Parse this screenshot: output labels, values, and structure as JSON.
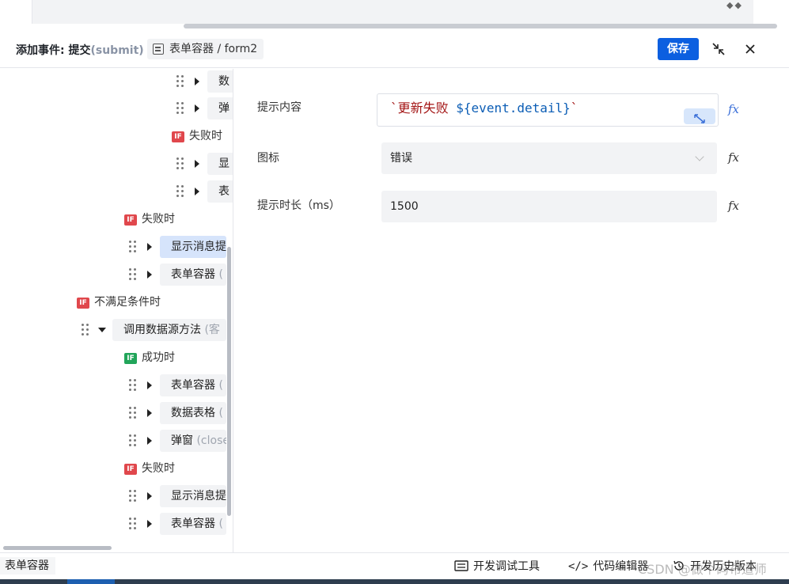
{
  "header": {
    "title": "添加事件: 提交",
    "title_sub": "(submit)",
    "crumb": "表单容器 / form2",
    "save_label": "保存"
  },
  "tree": {
    "nodes": [
      {
        "label": "数",
        "muted": ""
      },
      {
        "label": "弹",
        "muted": ""
      },
      {
        "label": "显",
        "muted": ""
      },
      {
        "label": "表",
        "muted": ""
      },
      {
        "label": "显示消息提",
        "muted": ""
      },
      {
        "label": "表单容器",
        "muted": " ("
      },
      {
        "label": "调用数据源方法",
        "muted": " (客"
      },
      {
        "label": "表单容器",
        "muted": " ("
      },
      {
        "label": "数据表格",
        "muted": " ("
      },
      {
        "label": "弹窗",
        "muted": " (close"
      },
      {
        "label": "显示消息提",
        "muted": ""
      },
      {
        "label": "表单容器",
        "muted": " ("
      }
    ],
    "conditions": [
      {
        "badge": "IF",
        "label": "失败时"
      },
      {
        "badge": "IF",
        "label": "失败时"
      },
      {
        "badge": "IF",
        "label": "不满足条件时"
      },
      {
        "badge": "IF",
        "label": "成功时"
      },
      {
        "badge": "IF",
        "label": "失败时"
      }
    ]
  },
  "form": {
    "fields": [
      {
        "label": "提示内容",
        "code_prefix": "`更新失败 ",
        "code_var": "${event.detail}",
        "code_suffix": "`"
      },
      {
        "label": "图标",
        "value": "错误"
      },
      {
        "label": "提示时长（ms）",
        "value": "1500"
      }
    ],
    "fx_label": "fx"
  },
  "footer": {
    "crumb": "表单容器",
    "tools": [
      "开发调试工具",
      "代码编辑器",
      "开发历史版本"
    ]
  },
  "watermark": "CSDN @做个码布道师",
  "colors": {
    "primary": "#0c5fe0",
    "if_red": "#e0474c",
    "if_green": "#22a55a",
    "active_node": "#d6e4fb"
  }
}
